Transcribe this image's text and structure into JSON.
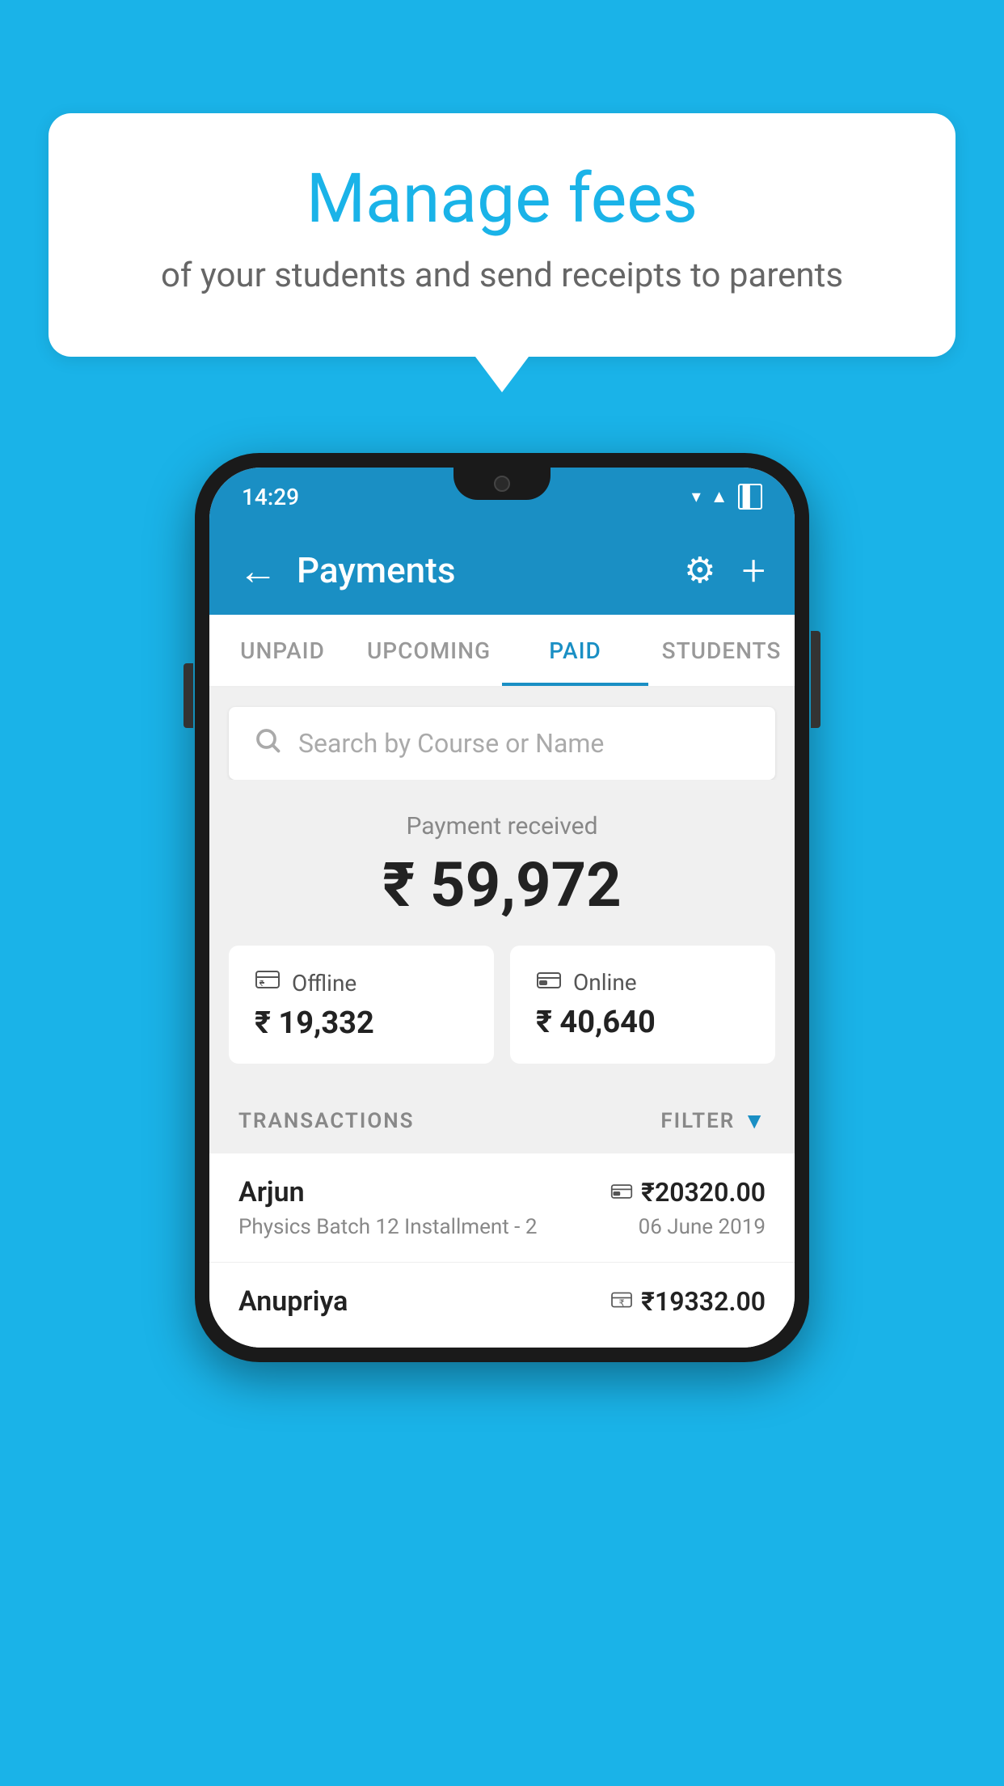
{
  "background": {
    "color": "#1ab3e8"
  },
  "speech_bubble": {
    "title": "Manage fees",
    "subtitle": "of your students and send receipts to parents"
  },
  "phone": {
    "status_bar": {
      "time": "14:29",
      "icons": [
        "wifi",
        "signal",
        "battery"
      ]
    },
    "header": {
      "back_label": "←",
      "title": "Payments",
      "settings_icon": "⚙",
      "add_icon": "+"
    },
    "tabs": [
      {
        "label": "UNPAID",
        "active": false
      },
      {
        "label": "UPCOMING",
        "active": false
      },
      {
        "label": "PAID",
        "active": true
      },
      {
        "label": "STUDENTS",
        "active": false
      }
    ],
    "search": {
      "placeholder": "Search by Course or Name"
    },
    "payment_summary": {
      "label": "Payment received",
      "amount": "₹ 59,972",
      "offline": {
        "icon": "💳",
        "type": "Offline",
        "amount": "₹ 19,332"
      },
      "online": {
        "icon": "💳",
        "type": "Online",
        "amount": "₹ 40,640"
      }
    },
    "transactions": {
      "header_label": "TRANSACTIONS",
      "filter_label": "FILTER",
      "items": [
        {
          "name": "Arjun",
          "amount": "₹20320.00",
          "course": "Physics Batch 12 Installment - 2",
          "date": "06 June 2019",
          "payment_type": "online"
        },
        {
          "name": "Anupriya",
          "amount": "₹19332.00",
          "course": "",
          "date": "",
          "payment_type": "offline"
        }
      ]
    }
  }
}
